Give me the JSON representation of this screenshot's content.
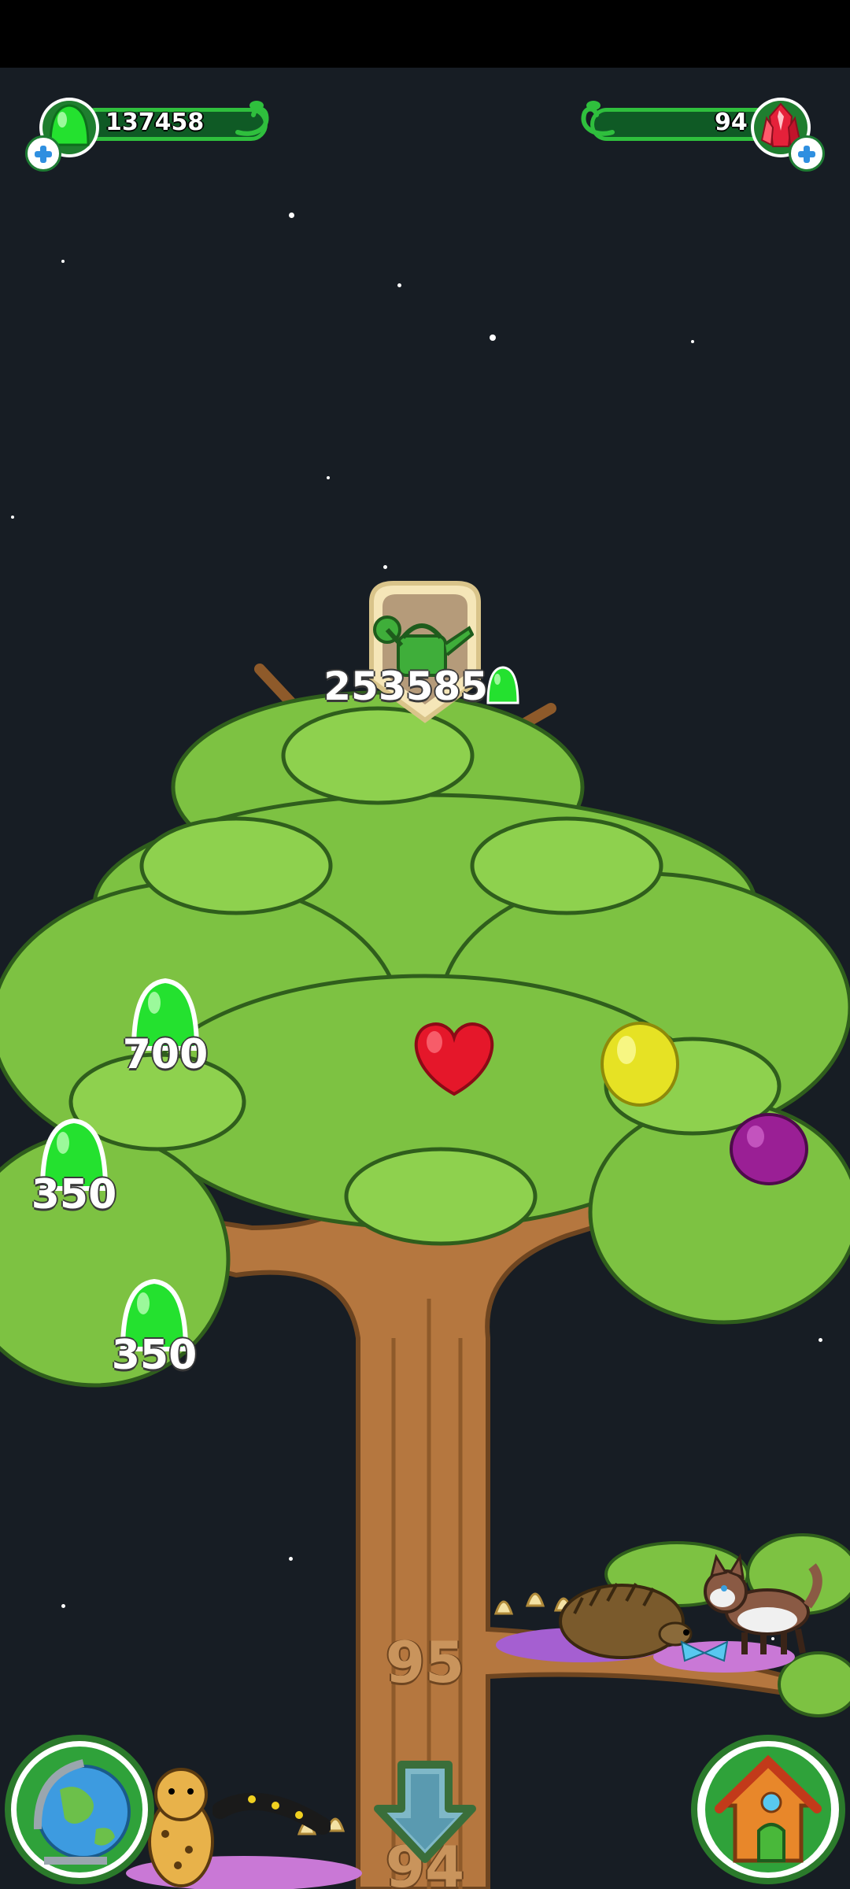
{
  "hud": {
    "gumdrops": {
      "value": "137458",
      "icon": "green-gumdrop-icon"
    },
    "crystals": {
      "value": "94",
      "icon": "red-crystal-icon"
    }
  },
  "tree_top": {
    "upgrade_cost": "253585",
    "icon": "watering-can-icon"
  },
  "branch_prices": [
    {
      "value": "700"
    },
    {
      "value": "350"
    },
    {
      "value": "350"
    }
  ],
  "fruits": [
    "red-heart-fruit",
    "yellow-fruit",
    "purple-fruit"
  ],
  "levels": {
    "current": "95",
    "below": "94"
  },
  "buttons": {
    "world": "globe-icon",
    "home": "house-icon",
    "down": "down-arrow-icon"
  },
  "colors": {
    "background": "#171d24",
    "hud_green": "#2fbf3d",
    "leaf": "#7dc242",
    "trunk": "#b5773f"
  }
}
